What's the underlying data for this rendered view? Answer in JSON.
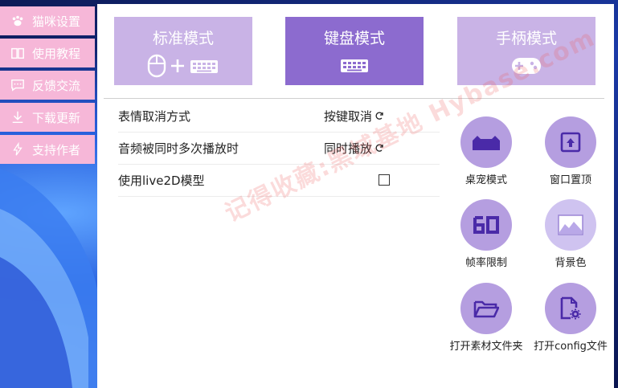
{
  "side_menu": {
    "items": [
      {
        "label": "猫咪设置",
        "icon": "paw-icon"
      },
      {
        "label": "使用教程",
        "icon": "book-icon"
      },
      {
        "label": "反馈交流",
        "icon": "chat-icon"
      },
      {
        "label": "下载更新",
        "icon": "download-icon"
      },
      {
        "label": "支持作者",
        "icon": "lightning-icon"
      }
    ]
  },
  "modes": [
    {
      "label": "标准模式",
      "icon": "mouse-plus-keyboard-icon",
      "active": false
    },
    {
      "label": "键盘模式",
      "icon": "keyboard-icon",
      "active": true
    },
    {
      "label": "手柄模式",
      "icon": "gamepad-icon",
      "active": false
    }
  ],
  "settings": [
    {
      "label": "表情取消方式",
      "value": "按键取消"
    },
    {
      "label": "音频被同时多次播放时",
      "value": "同时播放"
    },
    {
      "label": "使用live2D模型",
      "checked": false
    }
  ],
  "tools": [
    {
      "label": "桌宠模式",
      "icon": "desktop-pet-icon"
    },
    {
      "label": "窗口置顶",
      "icon": "pin-top-icon"
    },
    {
      "label": "帧率限制",
      "icon": "fps-60-icon"
    },
    {
      "label": "背景色",
      "icon": "background-image-icon"
    },
    {
      "label": "打开素材文件夹",
      "icon": "folder-open-icon"
    },
    {
      "label": "打开config文件",
      "icon": "config-file-icon"
    }
  ],
  "watermark": "记得收藏:黑域基地 Hybase.com",
  "colors": {
    "menu_bg": "#f6b7d8",
    "mode_inactive": "#c9b3e6",
    "mode_active": "#8c6bcf",
    "tool_circle": "#b59ee0",
    "icon_dark": "#4a2aa8"
  }
}
